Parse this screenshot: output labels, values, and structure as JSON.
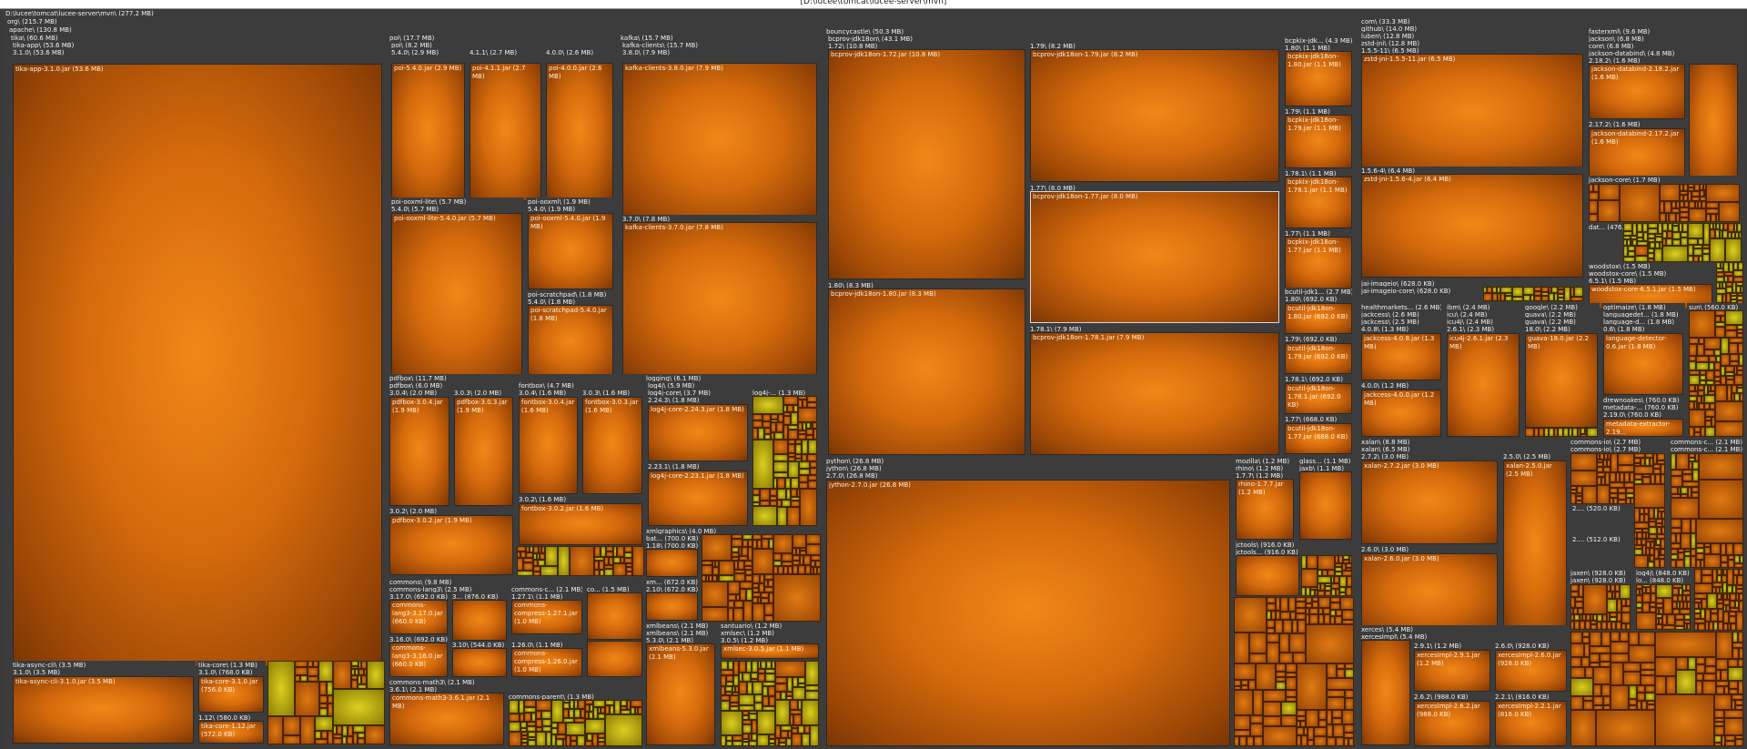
{
  "window": {
    "title": "[D:\\lucee\\tomcat\\lucee-server\\mvn]"
  },
  "root": {
    "label": "D:\\lucee\\tomcat\\lucee-server\\mvn\\ (277.2 MB)",
    "groups": {
      "org": "org\\ (215.7 MB)",
      "apache": "apache\\ (130.8 MB)",
      "tika": "tika\\ (60.6 MB)",
      "tika_app": "tika-app\\ (53.6 MB)",
      "tika_app_ver": "3.1.0\\ (53.6 MB)",
      "tika_app_jar": "tika-app-3.1.0.jar (53.6 MB)",
      "tika_async": "tika-async-cli\\ (3.5 MB)",
      "tika_async_ver": "3.1.0\\ (3.5 MB)",
      "tika_async_jar": "tika-async-cli-3.1.0.jar (3.5 MB)",
      "tika_core": "tika-core\\ (1.3 MB)",
      "tika_core_ver": "3.1.0\\ (768.0 KB)",
      "tika_core_jar": "tika-core-3.1.0.jar (756.0 KB)",
      "tika_core_112": "1.12\\ (580.0 KB)",
      "tika_core_112_jar": "tika-core-1.12.jar (572.0 KB)",
      "poi": "poi\\ (17.7 MB)",
      "poi_sub": "poi\\ (8.2 MB)",
      "poi_540": "5.4.0\\ (2.9 MB)",
      "poi_540_jar": "poi-5.4.0.jar (2.9 MB)",
      "poi_411": "4.1.1\\ (2.7 MB)",
      "poi_411_jar": "poi-4.1.1.jar (2.7 MB)",
      "poi_400": "4.0.0\\ (2.6 MB)",
      "poi_400_jar": "poi-4.0.0.jar (2.6 MB)",
      "poi_lite": "poi-ooxml-lite\\ (5.7 MB)",
      "poi_lite_ver": "5.4.0\\ (5.7 MB)",
      "poi_lite_jar": "poi-ooxml-lite-5.4.0.jar (5.7 MB)",
      "poi_ooxml": "poi-ooxml\\ (1.9 MB)",
      "poi_ooxml_ver": "5.4.0\\ (1.9 MB)",
      "poi_ooxml_jar": "poi-ooxml-5.4.0.jar (1.9 MB)",
      "poi_scratch": "poi-scratchpad\\ (1.8 MB)",
      "poi_scratch_ver": "5.4.0\\ (1.8 MB)",
      "poi_scratch_jar": "poi-scratchpad-5.4.0.jar (1.8 MB)",
      "kafka": "kafka\\ (15.7 MB)",
      "kafka_clients": "kafka-clients\\ (15.7 MB)",
      "kafka_380": "3.8.0\\ (7.9 MB)",
      "kafka_380_jar": "kafka-clients-3.8.0.jar (7.9 MB)",
      "kafka_370": "3.7.0\\ (7.8 MB)",
      "kafka_370_jar": "kafka-clients-3.7.0.jar (7.8 MB)",
      "pdfbox": "pdfbox\\ (11.7 MB)",
      "pdfbox_sub": "pdfbox\\ (6.0 MB)",
      "pdfbox_304": "3.0.4\\ (2.0 MB)",
      "pdfbox_304_jar": "pdfbox-3.0.4.jar (1.9 MB)",
      "pdfbox_303": "3.0.3\\ (2.0 MB)",
      "pdfbox_303_jar": "pdfbox-3.0.3.jar (1.9 MB)",
      "pdfbox_302": "3.0.2\\ (2.0 MB)",
      "pdfbox_302_jar": "pdfbox-3.0.2.jar (1.9 MB)",
      "fontbox": "fontbox\\ (4.7 MB)",
      "fontbox_304": "3.0.4\\ (1.6 MB)",
      "fontbox_304_jar": "fontbox-3.0.4.jar (1.6 MB)",
      "fontbox_303": "3.0.3\\ (1.6 MB)",
      "fontbox_303_jar": "fontbox-3.0.3.jar (1.6 MB)",
      "fontbox_302": "3.0.2\\ (1.6 MB)",
      "fontbox_302_jar": "fontbox-3.0.2.jar (1.6 MB)",
      "logging": "logging\\ (6.1 MB)",
      "log4j": "log4j\\ (5.9 MB)",
      "log4j_core": "log4j-core\\ (3.7 MB)",
      "log4j_2243": "2.24.3\\ (1.8 MB)",
      "log4j_2243_jar": "log4j-core-2.24.3.jar (1.8 MB)",
      "log4j_2231": "2.23.1\\ (1.8 MB)",
      "log4j_2231_jar": "log4j-core-2.23.1.jar (1.8 MB)",
      "log4j_other": "log4j-... (1.3 MB)",
      "xmlgraphics": "xmlgraphics\\ (4.0 MB)",
      "batik": "bat... (700.0 KB)",
      "batik_ver": "1.18\\ (700.0 KB)",
      "xmlg_sm": "xm... (672.0 KB)",
      "xmlg_sm_ver": "2.10\\ (672.0 KB)",
      "commons": "commons\\ (9.8 MB)",
      "lang3": "commons-lang3\\ (2.5 MB)",
      "lang3_3170": "3.17.0\\ (692.0 KB)",
      "lang3_3170_jar": "commons-lang3-3.17.0.jar (660.0 KB)",
      "lang3_3160": "3.16.0\\ (692.0 KB)",
      "lang3_3160_jar": "commons-lang3-3.16.0.jar (660.0 KB)",
      "lang3_3x": "3... (876.0 KB)",
      "lang3_310": "3.10\\ (544.0 KB)",
      "compress": "commons-c... (2.1 MB)",
      "compress_1271": "1.27.1\\ (1.1 MB)",
      "compress_1271_jar": "commons-compress-1.27.1.jar (1.0 MB)",
      "compress_1260": "1.26.0\\ (1.1 MB)",
      "compress_1260_jar": "commons-compress-1.26.0.jar (1.0 MB)",
      "commons_co": "co... (1.5 MB)",
      "math3": "commons-math3\\ (2.1 MB)",
      "math3_361": "3.6.1\\ (2.1 MB)",
      "math3_jar": "commons-math3-3.6.1.jar (2.1 MB)",
      "commons_parent": "commons-parent\\ (1.3 MB)",
      "xmlbeans": "xmlbeans\\ (2.1 MB)",
      "xmlbeans_sub": "xmlbeans\\ (2.1 MB)",
      "xmlbeans_530": "5.3.0\\ (2.1 MB)",
      "xmlbeans_jar": "xmlbeans-5.3.0.jar (2.1 MB)",
      "santuario": "santuario\\ (1.2 MB)",
      "xmlsec": "xmlsec\\ (1.2 MB)",
      "xmlsec_ver": "3.0.5\\ (1.2 MB)",
      "xmlsec_jar": "xmlsec-3.0.5.jar (1.1 MB)",
      "bc": "bouncycastle\\ (50.3 MB)",
      "bcprov": "bcprov-jdk18on\\ (43.1 MB)",
      "bc_172": "1.72\\ (10.8 MB)",
      "bc_172_jar": "bcprov-jdk18on-1.72.jar (10.8 MB)",
      "bc_179": "1.79\\ (8.2 MB)",
      "bc_179_jar": "bcprov-jdk18on-1.79.jar (8.2 MB)",
      "bc_177": "1.77\\ (8.0 MB)",
      "bc_177_jar": "bcprov-jdk18on-1.77.jar (8.0 MB)",
      "bc_180": "1.80\\ (8.3 MB)",
      "bc_180_jar": "bcprov-jdk18on-1.80.jar (8.3 MB)",
      "bc_1781": "1.78.1\\ (7.9 MB)",
      "bc_1781_jar": "bcprov-jdk18on-1.78.1.jar (7.9 MB)",
      "bcpkix": "bcpkix-jdk... (4.3 MB)",
      "bcpkix_180": "1.80\\ (1.1 MB)",
      "bcpkix_180_jar": "bcpkix-jdk18on-1.80.jar (1.1 MB)",
      "bcpkix_179": "1.79\\ (1.1 MB)",
      "bcpkix_179_jar": "bcpkix-jdk18on-1.79.jar (1.1 MB)",
      "bcpkix_1781": "1.78.1\\ (1.1 MB)",
      "bcpkix_1781_jar": "bcpkix-jdk18on-1.78.1.jar (1.1 MB)",
      "bcpkix_177": "1.77\\ (1.1 MB)",
      "bcpkix_177_jar": "bcpkix-jdk18on-1.77.jar (1.1 MB)",
      "bcutil": "bcutil-jdk1... (2.7 MB)",
      "bcutil_180": "1.80\\ (692.0 KB)",
      "bcutil_180_jar": "bcutil-jdk18on-1.80.jar (692.0 KB)",
      "bcutil_179": "1.79\\ (692.0 KB)",
      "bcutil_179_jar": "bcutil-jdk18on-1.79.jar (692.0 KB)",
      "bcutil_1781": "1.78.1\\ (692.0 KB)",
      "bcutil_1781_jar": "bcutil-jdk18on-1.78.1.jar (692.0 KB)",
      "bcutil_177": "1.77\\ (668.0 KB)",
      "bcutil_177_jar": "bcutil-jdk18on-1.77.jar (668.0 KB)",
      "python": "python\\ (26.8 MB)",
      "jython": "jython\\ (26.8 MB)",
      "jython_ver": "2.7.0\\ (26.8 MB)",
      "jython_jar": "jython-2.7.0.jar (26.8 MB)",
      "mozilla": "mozilla\\ (1.2 MB)",
      "rhino": "rhino\\ (1.2 MB)",
      "rhino_ver": "1.7.7\\ (1.2 MB)",
      "rhino_jar": "rhino-1.7.7.jar (1.2 MB)",
      "glass": "glass... (1.1 MB)",
      "jaxb": "jaxb\\ (1.1 MB)",
      "jctools": "jctools\\ (916.0 KB)",
      "jctools_sub": "jctools... (916.0 KB)",
      "com": "com\\ (33.3 MB)",
      "github": "github\\ (14.0 MB)",
      "luben": "luben\\ (12.8 MB)",
      "zstd": "zstd-jni\\ (12.8 MB)",
      "zstd_1511": "1.5.5-11\\ (6.5 MB)",
      "zstd_1511_jar": "zstd-jni-1.5.5-11.jar (6.5 MB)",
      "zstd_156": "1.5.6-4\\ (6.4 MB)",
      "zstd_156_jar": "zstd-jni-1.5.6-4.jar (6.4 MB)",
      "jai": "jai-imageio\\ (628.0 KB)",
      "jai_core": "jai-imageio-core\\ (628.0 KB)",
      "fasterxml": "fasterxml\\ (9.6 MB)",
      "jackson": "jackson\\ (6.8 MB)",
      "jackson_core": "core\\ (6.8 MB)",
      "databind": "jackson-databind\\ (4.8 MB)",
      "databind_2182": "2.18.2\\ (1.6 MB)",
      "databind_2182_jar": "jackson-databind-2.18.2.jar (1.6 MB)",
      "databind_2172": "2.17.2\\ (1.6 MB)",
      "databind_2172_jar": "jackson-databind-2.17.2.jar (1.6 MB)",
      "jcore": "jackson-core\\ (1.7 MB)",
      "dat": "dat... (476.0 KB)",
      "woodstox": "woodstox\\ (1.5 MB)",
      "woodstox_core": "woodstox-core\\ (1.5 MB)",
      "woodstox_ver": "6.5.1\\ (1.5 MB)",
      "woodstox_jar": "woodstox-core-6.5.1.jar (1.5 MB)",
      "hm": "healthmarkets... (2.6 MB)",
      "jackcess": "jackcess\\ (2.6 MB)",
      "jackcess_sub": "jackcess\\ (2.5 MB)",
      "jackcess_408": "4.0.8\\ (1.3 MB)",
      "jackcess_408_jar": "jackcess-4.0.8.jar (1.3 MB)",
      "jackcess_400": "4.0.0\\ (1.2 MB)",
      "jackcess_400_jar": "jackcess-4.0.0.jar (1.2 MB)",
      "ibm": "ibm\\ (2.4 MB)",
      "icu": "icu\\ (2.4 MB)",
      "icu4j": "icu4j\\ (2.4 MB)",
      "icu4j_ver": "2.6.1\\ (2.3 MB)",
      "icu4j_jar": "icu4j-2.6.1.jar (2.3 MB)",
      "google": "google\\ (2.2 MB)",
      "guava": "guava\\ (2.2 MB)",
      "guava_sub": "guava\\ (2.2 MB)",
      "guava_ver": "18.0\\ (2.2 MB)",
      "guava_jar": "guava-18.0.jar (2.2 MB)",
      "optimaize": "optimaize\\ (1.8 MB)",
      "langdet": "languagedet... (1.8 MB)",
      "langd": "language-d... (1.8 MB)",
      "lang_06": "0.6\\ (1.8 MB)",
      "lang_jar": "language-detector-0.6.jar (1.8 MB)",
      "drew": "drewnoakes\\ (760.0 KB)",
      "metadata": "metadata-... (760.0 KB)",
      "metadata_ver": "2.19.0\\ (760.0 KB)",
      "metadata_jar": "metadata-extractor-2.19...",
      "sun": "sun\\ (560.0 KB)",
      "xalan": "xalan\\ (8.8 MB)",
      "xalan_sub": "xalan\\ (6.5 MB)",
      "xalan_272": "2.7.2\\ (3.0 MB)",
      "xalan_272_jar": "xalan-2.7.2.jar (3.0 MB)",
      "xalan_250": "2.5.0\\ (2.5 MB)",
      "xalan_250_jar": "xalan-2.5.0.jar (2.5 MB)",
      "xalan_260": "2.6.0\\ (3.0 MB)",
      "xalan_260_jar": "xalan-2.6.0.jar (3.0 MB)",
      "xerces": "xerces\\ (5.4 MB)",
      "xercesimpl": "xercesImpl\\ (5.4 MB)",
      "xerces_291": "2.9.1\\ (1.2 MB)",
      "xerces_291_jar": "xercesImpl-2.9.1.jar (1.2 MB)",
      "xerces_260": "2.6.0\\ (928.0 KB)",
      "xerces_260_jar": "xercesImpl-2.6.0.jar (928.0 KB)",
      "xerces_262": "2.6.2\\ (988.0 KB)",
      "xerces_262_jar": "xercesImpl-2.6.2.jar (988.0 KB)",
      "xerces_221": "2.2.1\\ (816.0 KB)",
      "xerces_221_jar": "xercesImpl-2.2.1.jar (816.0 KB)",
      "cio": "commons-io\\ (2.7 MB)",
      "cio_sub": "commons-io\\ (2.7 MB)",
      "cio_2a": "2.... (520.0 KB)",
      "cio_2b": "2.... (512.0 KB)",
      "cc": "commons-c... (2.1 MB)",
      "cc_sub": "commons-c... (2.1 MB)",
      "jaxen": "jaxen\\ (928.0 KB)",
      "jaxen_sub": "jaxen\\ (928.0 KB)",
      "log4j2": "log4j\\ (848.0 KB)",
      "log4j2_io": "lo... (848.0 KB)"
    }
  },
  "colors": {
    "file": "#e07a12",
    "file_small": "#c8b414",
    "folder": "#3c3c3c",
    "selected_outline": "#d8d8d8"
  }
}
